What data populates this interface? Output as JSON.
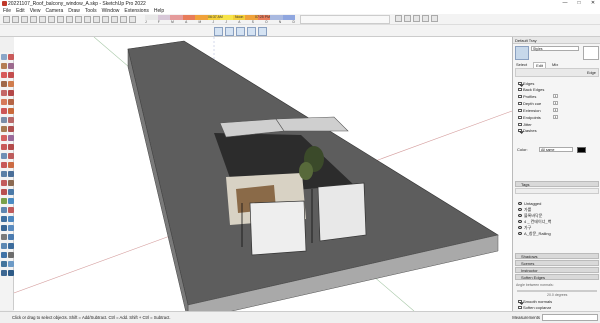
{
  "window": {
    "title": "20221107_Roof_balcony_window_A.skp - SketchUp Pro 2022",
    "controls": [
      "—",
      "□",
      "✕"
    ]
  },
  "menu": [
    "File",
    "Edit",
    "View",
    "Camera",
    "Draw",
    "Tools",
    "Window",
    "Extensions",
    "Help"
  ],
  "shadow": {
    "months": [
      "J",
      "F",
      "M",
      "A",
      "M",
      "J",
      "J",
      "A",
      "S",
      "O",
      "N",
      "D"
    ],
    "time_start": "06:37 AM",
    "time_noon": "Noon",
    "time_end": "07:25 PM"
  },
  "default_tray": {
    "title": "Default Tray",
    "subtitle": "Styles",
    "tabs": [
      "Select",
      "Edit",
      "Mix"
    ],
    "active_tab": "Edit",
    "section_label": "Edge",
    "edge_settings": [
      {
        "label": "Edges",
        "checked": true
      },
      {
        "label": "Back Edges",
        "checked": false
      },
      {
        "label": "Profiles",
        "checked": false,
        "value": "1"
      },
      {
        "label": "Depth cue",
        "checked": false,
        "value": "1"
      },
      {
        "label": "Extension",
        "checked": false,
        "value": "1"
      },
      {
        "label": "Endpoints",
        "checked": false,
        "value": "1"
      },
      {
        "label": "Jitter",
        "checked": false
      },
      {
        "label": "Dashes",
        "checked": true
      }
    ],
    "color_label": "Color:",
    "color_value": "All same",
    "color_swatch": "#000000"
  },
  "tags": {
    "header": "Tags",
    "items": [
      "Untagged",
      "가를",
      "블록바닥문",
      "4 _ 컨테이너_벽",
      "가구",
      "A_창문_Railing"
    ]
  },
  "collapsed_sections": [
    "Shadows",
    "Scenes",
    "Instructor",
    "Soften Edges"
  ],
  "soften": {
    "label": "Angle between normals:",
    "value": "20.0 degrees",
    "options": [
      {
        "label": "Smooth normals",
        "checked": true
      },
      {
        "label": "Soften coplanar",
        "checked": false
      }
    ]
  },
  "status": {
    "hint": "Click or drag to select objects. Shift = Add/Subtract. Ctrl = Add. Shift + Ctrl = Subtract.",
    "measurements_label": "Measurements"
  },
  "colors": {
    "roof": "#5d5d5d",
    "roof_edge": "#8a8a8a",
    "accent_blue": "#2f6fb3"
  }
}
